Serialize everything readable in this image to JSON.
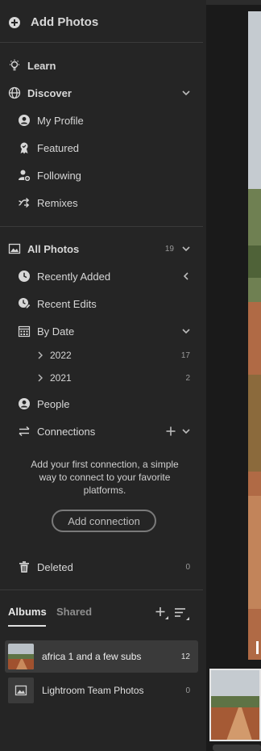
{
  "header": {
    "add_photos": "Add Photos"
  },
  "learn": {
    "label": "Learn"
  },
  "discover": {
    "label": "Discover",
    "items": [
      {
        "label": "My Profile",
        "icon": "user-circle-icon"
      },
      {
        "label": "Featured",
        "icon": "award-icon"
      },
      {
        "label": "Following",
        "icon": "user-plus-icon"
      },
      {
        "label": "Remixes",
        "icon": "remix-icon"
      }
    ]
  },
  "all_photos": {
    "label": "All Photos",
    "count": "19"
  },
  "library": {
    "recently_added": "Recently Added",
    "recent_edits": "Recent Edits",
    "by_date": "By Date",
    "years": [
      {
        "label": "2022",
        "count": "17"
      },
      {
        "label": "2021",
        "count": "2"
      }
    ],
    "people": "People",
    "connections": "Connections"
  },
  "connections_hint": "Add your first connection, a simple way to connect to your favorite platforms.",
  "add_connection": "Add connection",
  "deleted": {
    "label": "Deleted",
    "count": "0"
  },
  "tabs": {
    "albums": "Albums",
    "shared": "Shared"
  },
  "albums": [
    {
      "name": "africa 1 and a few subs",
      "count": "12",
      "selected": true
    },
    {
      "name": "Lightroom Team Photos",
      "count": "0",
      "selected": false
    }
  ],
  "colors": {
    "sidebar_bg": "#252525",
    "selected_bg": "#3a3a3a",
    "text": "#d7d7d7"
  }
}
